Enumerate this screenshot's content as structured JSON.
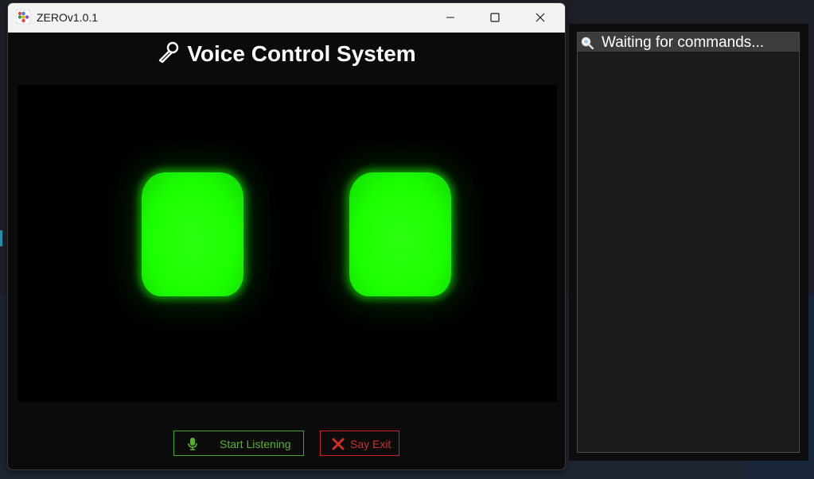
{
  "window": {
    "title": "ZEROv1.0.1",
    "controls": [
      "minimize",
      "maximize",
      "close"
    ]
  },
  "header": {
    "icon": "microphone-icon",
    "title": "Voice Control System"
  },
  "buttons": {
    "start_listening": {
      "label": "Start Listening",
      "icon": "microphone-icon",
      "color": "#56b42a"
    },
    "say_exit": {
      "label": "Say Exit",
      "icon": "x-icon",
      "color": "#d42a2a"
    }
  },
  "eyes": {
    "color": "#1cff00"
  },
  "side_panel": {
    "status_icon": "magnifier-icon",
    "status_text": "Waiting for commands..."
  }
}
